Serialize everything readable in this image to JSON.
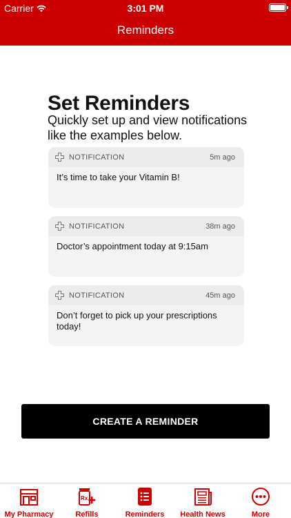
{
  "status_bar": {
    "carrier": "Carrier",
    "time": "3:01 PM"
  },
  "nav": {
    "title": "Reminders"
  },
  "main": {
    "heading": "Set Reminders",
    "subtitle": "Quickly set up and view notifications like the examples below."
  },
  "notifications": [
    {
      "app": "NOTIFICATION",
      "time": "5m ago",
      "message": "It’s time to take your Vitamin B!"
    },
    {
      "app": "NOTIFICATION",
      "time": "38m ago",
      "message": "Doctor’s appointment today at 9:15am"
    },
    {
      "app": "NOTIFICATION",
      "time": "45m ago",
      "message": "Don’t forget to pick up your prescriptions today!"
    }
  ],
  "create_button": {
    "label": "CREATE A REMINDER"
  },
  "tabs": [
    {
      "label": "My Pharmacy",
      "icon": "storefront-icon"
    },
    {
      "label": "Refills",
      "icon": "rx-plus-icon"
    },
    {
      "label": "Reminders",
      "icon": "reminders-list-icon",
      "active": true
    },
    {
      "label": "Health News",
      "icon": "newspaper-icon"
    },
    {
      "label": "More",
      "icon": "more-dots-icon"
    }
  ],
  "colors": {
    "brand_red": "#cc0000",
    "button_black": "#000000",
    "card_bg": "#f4f4f4"
  }
}
